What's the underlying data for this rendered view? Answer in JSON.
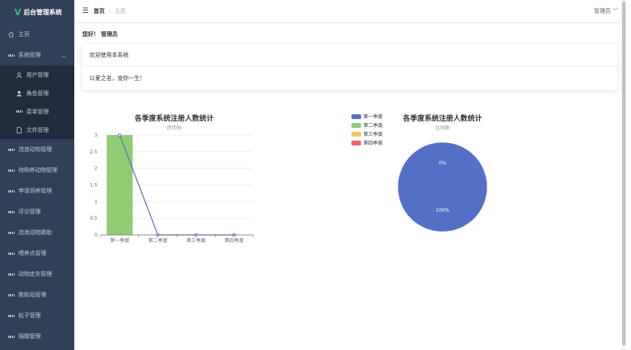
{
  "app": {
    "title": "后台管理系统",
    "logo_letter": "V"
  },
  "sidebar": {
    "items": [
      {
        "label": "主页",
        "icon": "home-icon"
      },
      {
        "label": "系统管理",
        "icon": "grid-icon",
        "expanded": true,
        "children": [
          {
            "label": "用户管理",
            "icon": "user-icon"
          },
          {
            "label": "角色管理",
            "icon": "user-filled-icon"
          },
          {
            "label": "菜单管理",
            "icon": "grid-icon"
          },
          {
            "label": "文件管理",
            "icon": "document-icon"
          }
        ]
      },
      {
        "label": "流浪动物管理",
        "icon": "grid-icon"
      },
      {
        "label": "待购养动物管理",
        "icon": "grid-icon"
      },
      {
        "label": "申请领养管理",
        "icon": "grid-icon"
      },
      {
        "label": "评论管理",
        "icon": "grid-icon"
      },
      {
        "label": "流浪动物救助",
        "icon": "grid-icon"
      },
      {
        "label": "喂养点管理",
        "icon": "grid-icon"
      },
      {
        "label": "动物走失管理",
        "icon": "grid-icon"
      },
      {
        "label": "救助站管理",
        "icon": "grid-icon"
      },
      {
        "label": "帖子管理",
        "icon": "grid-icon"
      },
      {
        "label": "捐赠管理",
        "icon": "grid-icon"
      }
    ]
  },
  "navbar": {
    "breadcrumb_home": "首页",
    "breadcrumb_sep": "/",
    "breadcrumb_current": "主页",
    "user": "管理员"
  },
  "greeting": "您好！ 管理员",
  "notice": {
    "title": "欢迎使用本系统",
    "body": "以爱之名，宠你一生！"
  },
  "colors": {
    "sidebar_bg": "#304156",
    "blue": "#5470c6",
    "green": "#91cc75",
    "yellow": "#fac858",
    "red": "#ee6666"
  },
  "chart_data": [
    {
      "type": "bar",
      "title": "各季度系统注册人数统计",
      "subtitle": "趋势图",
      "categories": [
        "第一季度",
        "第二季度",
        "第三季度",
        "第四季度"
      ],
      "series": [
        {
          "type": "bar",
          "values": [
            3,
            0,
            0,
            0
          ],
          "color": "#91cc75"
        },
        {
          "type": "line",
          "values": [
            3,
            0,
            0,
            0
          ],
          "color": "#5470c6"
        }
      ],
      "ylim": [
        0,
        3
      ],
      "yticks": [
        "0",
        "0.5",
        "1",
        "1.5",
        "2",
        "2.5",
        "3"
      ],
      "grid": true
    },
    {
      "type": "pie",
      "title": "各季度系统注册人数统计",
      "subtitle": "比例图",
      "legend": [
        "第一季度",
        "第二季度",
        "第三季度",
        "第四季度"
      ],
      "legend_position": "left",
      "values": [
        3,
        0,
        0,
        0
      ],
      "colors": [
        "#5470c6",
        "#91cc75",
        "#fac858",
        "#ee6666"
      ],
      "labels": [
        "100%",
        "0%"
      ]
    }
  ]
}
